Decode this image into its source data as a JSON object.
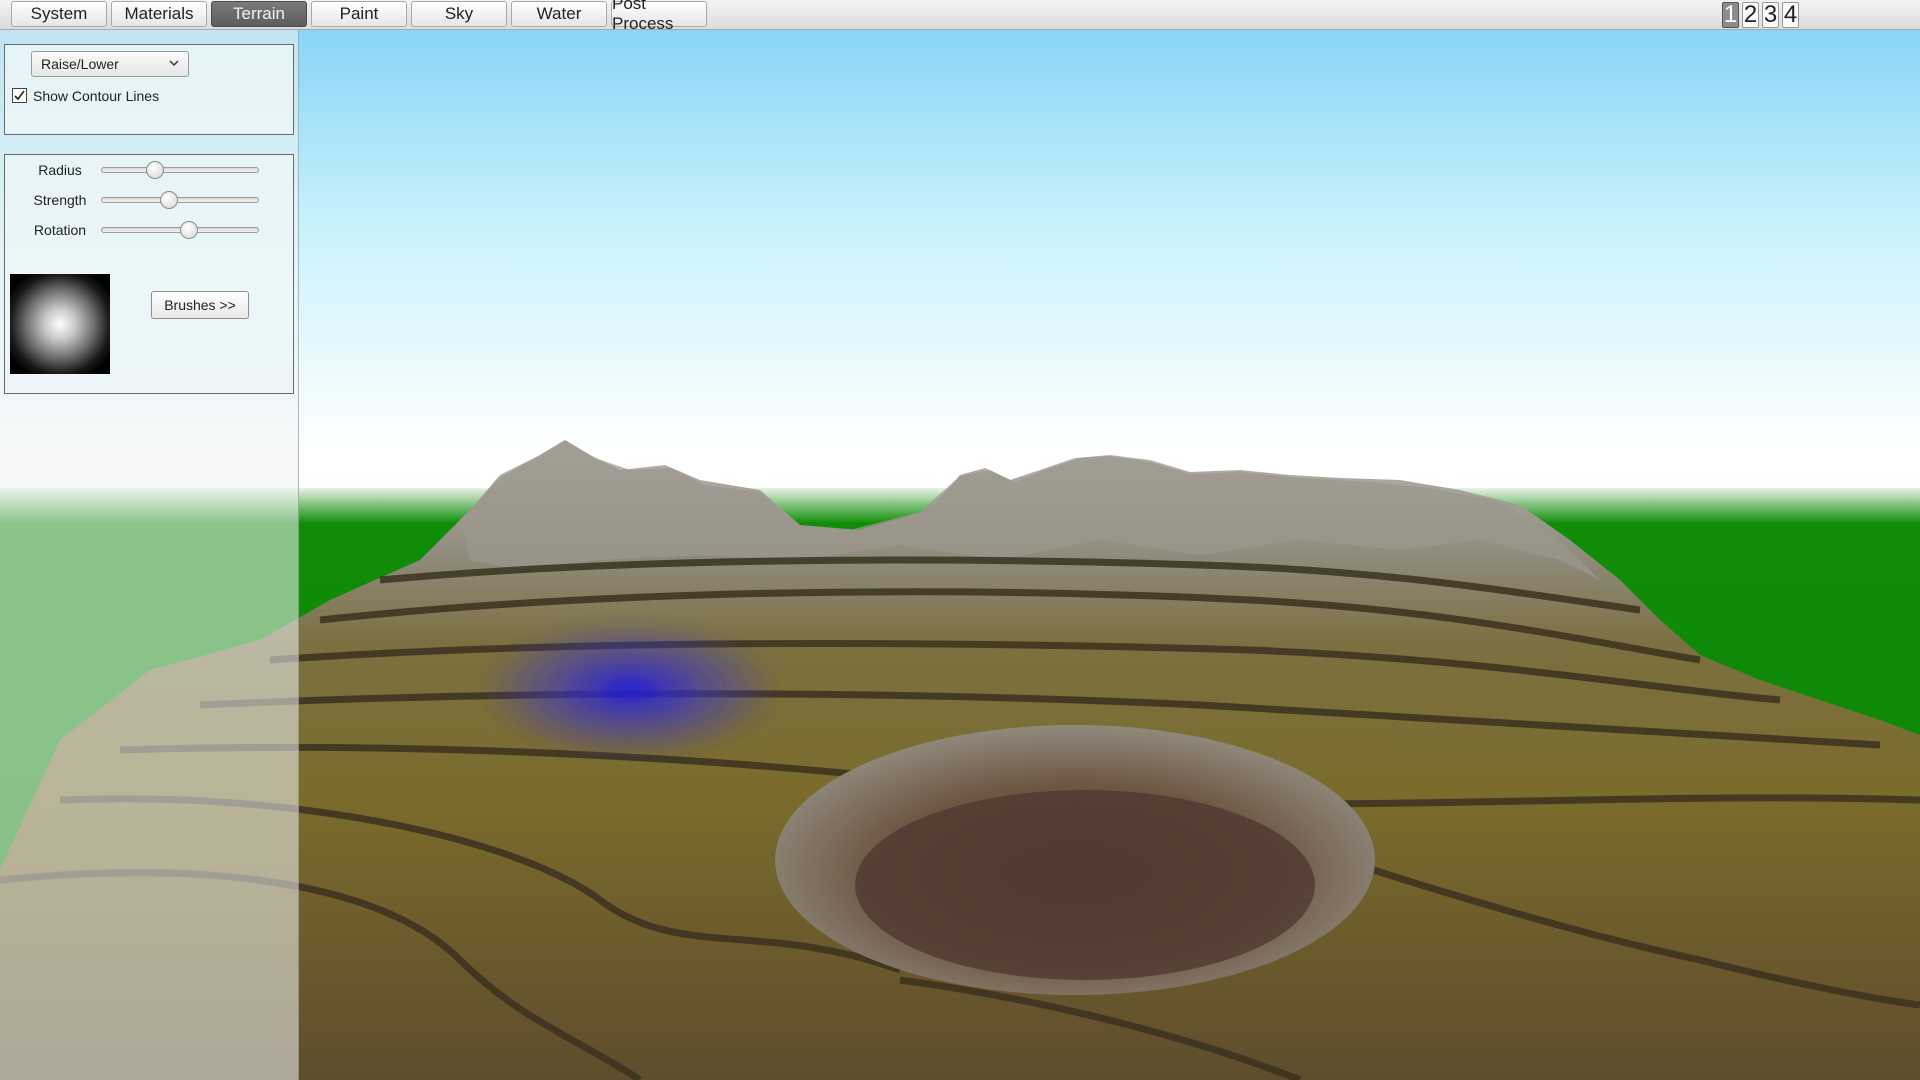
{
  "toolbar": {
    "tabs": [
      {
        "label": "System"
      },
      {
        "label": "Materials"
      },
      {
        "label": "Terrain"
      },
      {
        "label": "Paint"
      },
      {
        "label": "Sky"
      },
      {
        "label": "Water"
      },
      {
        "label": "Post Process"
      }
    ],
    "active_tab": "Terrain",
    "cameras": [
      "1",
      "2",
      "3",
      "4"
    ],
    "active_camera": "1"
  },
  "tool_panel": {
    "mode_select": {
      "value": "Raise/Lower",
      "icon": "chevron-down-icon"
    },
    "contour": {
      "label": "Show Contour Lines",
      "checked": true,
      "icon": "checkmark-icon"
    }
  },
  "brush_panel": {
    "sliders": [
      {
        "label": "Radius",
        "value": 0.34
      },
      {
        "label": "Strength",
        "value": 0.43
      },
      {
        "label": "Rotation",
        "value": 0.56
      }
    ],
    "brushes_button": "Brushes >>"
  },
  "colors": {
    "sky_top": "#86d3f8",
    "sky_horizon": "#ffffff",
    "ground": "#108c08",
    "terrain_grass": "#7a6a26",
    "terrain_rock": "#8e8a80",
    "brush_marker": "#2a25d8",
    "active_tab": "#6b6b6b"
  }
}
